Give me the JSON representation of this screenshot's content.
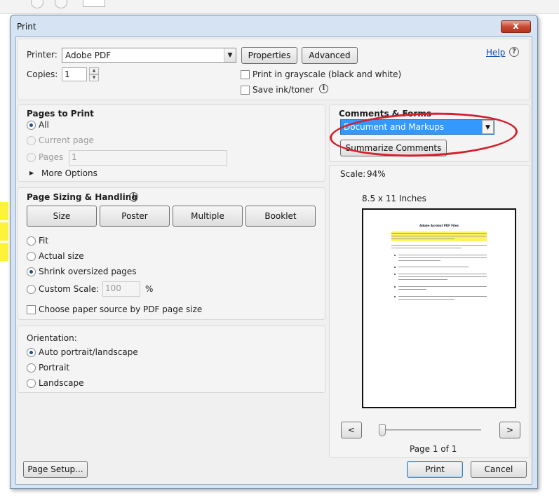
{
  "dialog": {
    "title": "Print",
    "close_glyph": "x"
  },
  "printer": {
    "label": "Printer:",
    "selected": "Adobe PDF",
    "properties_label": "Properties",
    "advanced_label": "Advanced",
    "help_label": "Help",
    "copies_label": "Copies:",
    "copies_value": "1",
    "grayscale_label": "Print in grayscale (black and white)",
    "grayscale_checked": false,
    "save_ink_label": "Save ink/toner",
    "save_ink_checked": false
  },
  "pages_to_print": {
    "heading": "Pages to Print",
    "all_label": "All",
    "current_page_label": "Current page",
    "pages_label": "Pages",
    "pages_value": "1",
    "more_options_label": "More Options",
    "selected": "All"
  },
  "sizing": {
    "heading": "Page Sizing & Handling",
    "buttons": [
      "Size",
      "Poster",
      "Multiple",
      "Booklet"
    ],
    "fit_label": "Fit",
    "actual_size_label": "Actual size",
    "shrink_label": "Shrink oversized pages",
    "custom_scale_label": "Custom Scale:",
    "custom_scale_value": "100",
    "percent_symbol": "%",
    "paper_source_label": "Choose paper source by PDF page size",
    "selected": "Shrink oversized pages",
    "paper_source_checked": false
  },
  "orientation": {
    "heading": "Orientation:",
    "auto_label": "Auto portrait/landscape",
    "portrait_label": "Portrait",
    "landscape_label": "Landscape",
    "selected": "Auto portrait/landscape"
  },
  "comments": {
    "heading": "Comments & Forms",
    "selected": "Document and Markups",
    "summarize_label": "Summarize Comments"
  },
  "preview": {
    "scale_label": "Scale:",
    "scale_value": "94%",
    "paper_size": "8.5 x 11 Inches",
    "mini_title": "Adobe Acrobat PDF Files",
    "page_indicator": "Page 1 of 1",
    "prev_glyph": "<",
    "next_glyph": ">",
    "slider_position_fraction": 0.0
  },
  "footer": {
    "page_setup_label": "Page Setup...",
    "print_label": "Print",
    "cancel_label": "Cancel"
  },
  "colors": {
    "annotation_oval": "#d4202a",
    "selection_highlight": "#3399ff",
    "help_link": "#0b4fb3"
  }
}
